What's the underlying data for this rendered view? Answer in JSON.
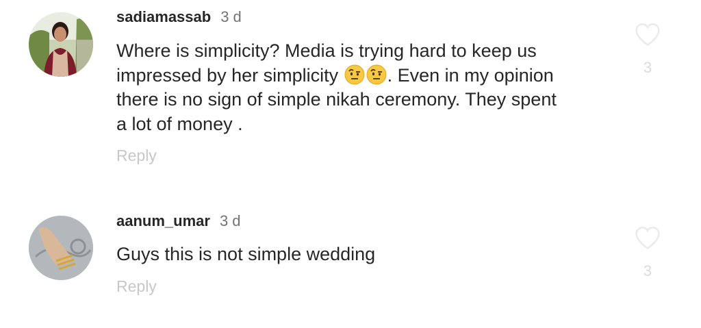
{
  "comments": [
    {
      "username": "sadiamassab",
      "time": "3 d",
      "text_lines": [
        "Where is simplicity? Media is trying hard to keep us",
        "impressed by her simplicity",
        ". Even in my opinion",
        "there is no sign of simple nikah ceremony. They  spent",
        "a lot of money ."
      ],
      "emoji": [
        "raised-eyebrow-emoji",
        "raised-eyebrow-emoji"
      ],
      "reply_label": "Reply",
      "like_count": "3"
    },
    {
      "username": "aanum_umar",
      "time": "3 d",
      "text_lines": [
        "Guys this is not simple wedding"
      ],
      "reply_label": "Reply",
      "like_count": "3"
    }
  ],
  "colors": {
    "username": "#262626",
    "text": "#262626",
    "timestamp": "#737373",
    "reply": "#c7c7c7",
    "like_icon": "#ebebeb",
    "like_count": "#dbdbdb"
  }
}
